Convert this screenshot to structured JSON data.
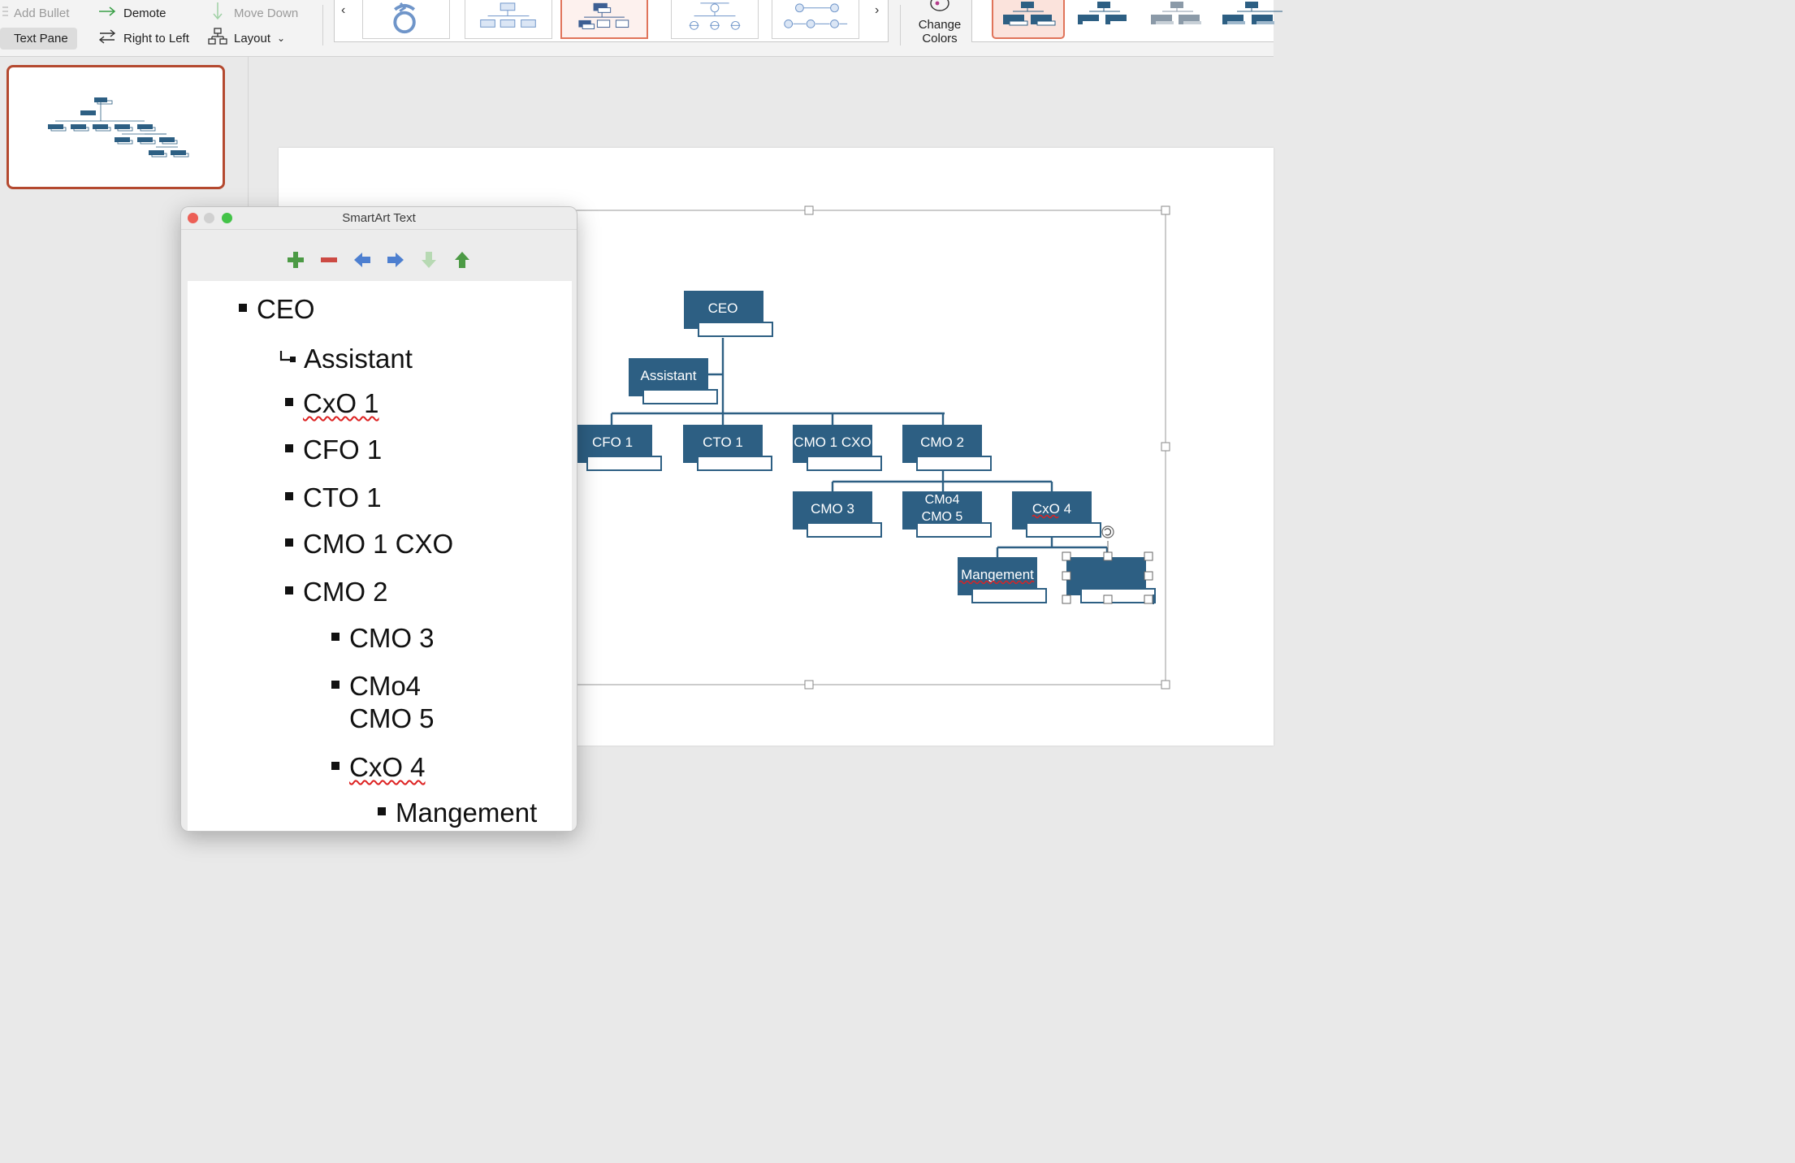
{
  "ribbon": {
    "add_bullet": "Add Bullet",
    "demote": "Demote",
    "move_down": "Move Down",
    "text_pane": "Text Pane",
    "right_to_left": "Right to Left",
    "layout": "Layout",
    "change_colors_line1": "Change",
    "change_colors_line2": "Colors",
    "icons": {
      "add_bullet": "add-bullet-icon",
      "demote": "arrow-right-icon",
      "move_down": "arrow-down-icon",
      "right_to_left": "swap-arrows-icon",
      "layout": "org-layout-icon",
      "change_colors": "palette-icon"
    }
  },
  "smartart_pane": {
    "title": "SmartArt Text",
    "toolbar_icons": [
      "plus-icon",
      "minus-icon",
      "arrow-left-icon",
      "arrow-right-icon",
      "arrow-down-icon",
      "arrow-up-icon"
    ],
    "items": [
      {
        "text": "CEO",
        "level": 0,
        "bullet": "square"
      },
      {
        "text": "Assistant",
        "level": 1,
        "bullet": "assistant"
      },
      {
        "text": "CxO 1",
        "level": 1,
        "bullet": "square",
        "misspelled": true
      },
      {
        "text": "CFO 1",
        "level": 1,
        "bullet": "square"
      },
      {
        "text": "CTO 1",
        "level": 1,
        "bullet": "square"
      },
      {
        "text": "CMO 1 CXO",
        "level": 1,
        "bullet": "square"
      },
      {
        "text": "CMO 2",
        "level": 1,
        "bullet": "square"
      },
      {
        "text": "CMO 3",
        "level": 2,
        "bullet": "square"
      },
      {
        "text": "CMo4",
        "text2": "CMO 5",
        "level": 2,
        "bullet": "square"
      },
      {
        "text": "CxO 4",
        "level": 2,
        "bullet": "square",
        "misspelled": true
      },
      {
        "text": "Mangement",
        "level": 3,
        "bullet": "square"
      }
    ]
  },
  "org_chart": {
    "box_color": "#2d5f83",
    "nodes": {
      "ceo": "CEO",
      "assistant": "Assistant",
      "cfo1": "CFO 1",
      "cto1": "CTO 1",
      "cmo1cxo": "CMO 1 CXO",
      "cmo2": "CMO 2",
      "cmo3": "CMO 3",
      "cmo4": "CMo4",
      "cmo5": "CMO 5",
      "cxo4": "CxO 4",
      "mangement": "Mangement"
    }
  },
  "colors": {
    "selection_accent": "#e0745a",
    "thumbnail_border": "#b4492f",
    "spelling_underline": "#dd2222"
  }
}
